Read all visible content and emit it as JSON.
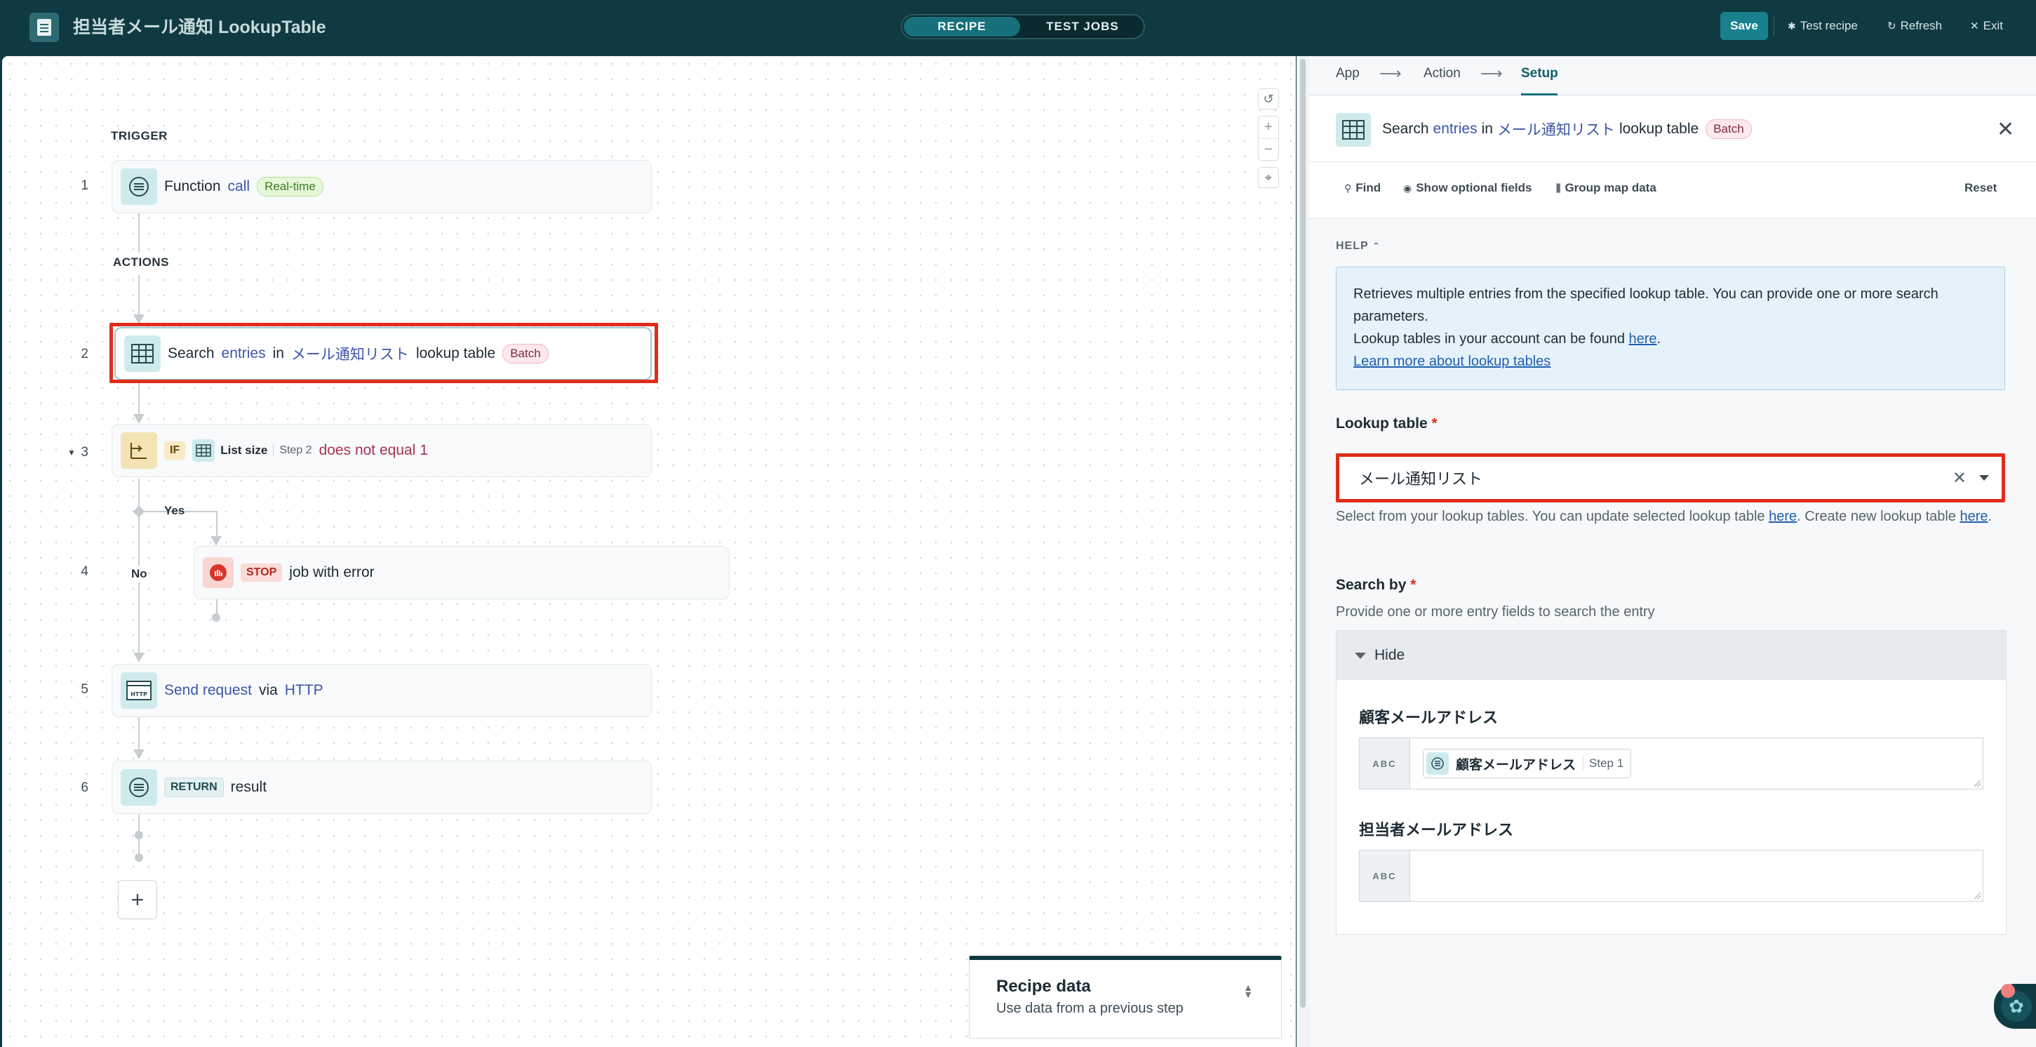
{
  "header": {
    "title": "担当者メール通知 LookupTable",
    "tabs": [
      "RECIPE",
      "TEST JOBS"
    ],
    "save": "Save",
    "test_recipe": "Test recipe",
    "refresh": "Refresh",
    "exit": "Exit"
  },
  "canvas": {
    "trigger_label": "TRIGGER",
    "actions_label": "ACTIONS",
    "steps": [
      {
        "num": "1",
        "text": "Function",
        "kw": "call",
        "badge": "Real-time"
      },
      {
        "num": "2",
        "text": "Search",
        "kw": "entries",
        "mid": "in",
        "kw2": "メール通知リスト",
        "tail": "lookup table",
        "badge": "Batch"
      },
      {
        "num": "3",
        "tag": "IF",
        "pill_name": "List size",
        "pill_step": "Step 2",
        "cond": "does not equal",
        "value": "1"
      },
      {
        "num": "4",
        "tag": "STOP",
        "text": "job with error"
      },
      {
        "num": "5",
        "kw": "Send request",
        "mid": "via",
        "kw2": "HTTP"
      },
      {
        "num": "6",
        "tag": "RETURN",
        "text": "result"
      }
    ],
    "branch_yes": "Yes",
    "branch_no": "No",
    "add": "+",
    "recipe_data": {
      "title": "Recipe data",
      "subtitle": "Use data from a previous step"
    }
  },
  "panel": {
    "crumbs": [
      "App",
      "Action",
      "Setup"
    ],
    "step_title": {
      "a": "Search",
      "kw": "entries",
      "b": "in",
      "kw2": "メール通知リスト",
      "c": "lookup table",
      "badge": "Batch"
    },
    "toolbar": {
      "find": "Find",
      "optional": "Show optional fields",
      "group": "Group map data",
      "reset": "Reset"
    },
    "help_label": "HELP",
    "help": {
      "line1": "Retrieves multiple entries from the specified lookup table. You can provide one or more search parameters.",
      "line2": "Lookup tables in your account can be found ",
      "here": "here",
      "learn": "Learn more about lookup tables"
    },
    "lookup_label": "Lookup table",
    "lookup_value": "メール通知リスト",
    "lookup_hint_a": "Select from your lookup tables. You can update selected lookup table ",
    "lookup_hint_here1": "here",
    "lookup_hint_b": ". Create new lookup table ",
    "lookup_hint_here2": "here",
    "search_by_label": "Search by",
    "search_by_hint": "Provide one or more entry fields to search the entry",
    "hide": "Hide",
    "fields": [
      {
        "label": "顧客メールアドレス",
        "type": "ABC",
        "pill": "顧客メールアドレス",
        "pill_step": "Step 1"
      },
      {
        "label": "担当者メールアドレス",
        "type": "ABC"
      }
    ]
  }
}
